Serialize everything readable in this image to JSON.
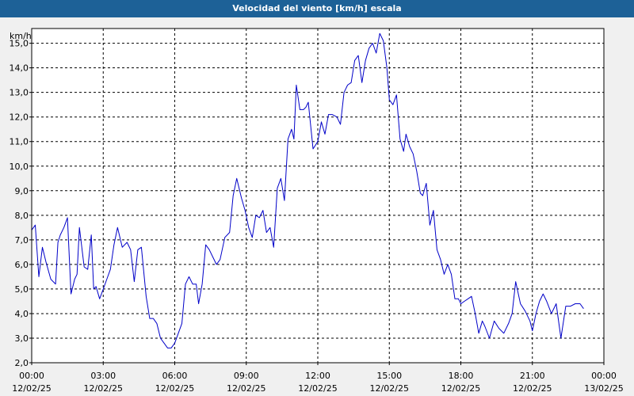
{
  "window": {
    "title": "Velocidad del viento [km/h] escala"
  },
  "chart_data": {
    "type": "line",
    "title": "Velocidad del viento [km/h] escala",
    "ylabel": "km/h",
    "xlabel": "",
    "ylim": [
      2.0,
      15.6
    ],
    "xlim": [
      "12/02/25 00:00",
      "13/02/25 00:00"
    ],
    "grid": true,
    "y_ticks": [
      "2,0",
      "3,0",
      "4,0",
      "5,0",
      "6,0",
      "7,0",
      "8,0",
      "9,0",
      "10,0",
      "11,0",
      "12,0",
      "13,0",
      "14,0",
      "15,0"
    ],
    "x_ticks": [
      {
        "time": "00:00",
        "date": "12/02/25"
      },
      {
        "time": "03:00",
        "date": "12/02/25"
      },
      {
        "time": "06:00",
        "date": "12/02/25"
      },
      {
        "time": "09:00",
        "date": "12/02/25"
      },
      {
        "time": "12:00",
        "date": "12/02/25"
      },
      {
        "time": "15:00",
        "date": "12/02/25"
      },
      {
        "time": "18:00",
        "date": "12/02/25"
      },
      {
        "time": "21:00",
        "date": "12/02/25"
      },
      {
        "time": "00:00",
        "date": "13/02/25"
      }
    ],
    "colors": {
      "series": "#0000c8",
      "grid": "#000000",
      "plot_bg": "#ffffff"
    },
    "series": [
      {
        "x_hours": [
          0.0,
          0.15,
          0.3,
          0.45,
          0.6,
          0.8,
          1.0,
          1.1,
          1.2,
          1.35,
          1.5,
          1.65,
          1.8,
          1.9,
          2.0,
          2.2,
          2.35,
          2.5,
          2.6,
          2.7,
          2.85,
          3.0,
          3.15,
          3.3,
          3.45,
          3.6,
          3.8,
          4.0,
          4.15,
          4.3,
          4.45,
          4.6,
          4.8,
          4.95,
          5.1,
          5.25,
          5.4,
          5.55,
          5.7,
          5.85,
          6.0,
          6.15,
          6.3,
          6.45,
          6.6,
          6.75,
          6.9,
          7.0,
          7.15,
          7.3,
          7.45,
          7.6,
          7.75,
          7.9,
          8.1,
          8.3,
          8.45,
          8.6,
          8.8,
          8.95,
          9.1,
          9.25,
          9.4,
          9.55,
          9.7,
          9.85,
          10.0,
          10.15,
          10.3,
          10.45,
          10.6,
          10.75,
          10.9,
          11.0,
          11.1,
          11.25,
          11.4,
          11.5,
          11.6,
          11.8,
          12.0,
          12.15,
          12.3,
          12.45,
          12.6,
          12.8,
          12.95,
          13.1,
          13.25,
          13.4,
          13.55,
          13.7,
          13.85,
          14.0,
          14.15,
          14.3,
          14.45,
          14.6,
          14.75,
          14.9,
          15.0,
          15.15,
          15.3,
          15.45,
          15.6,
          15.7,
          15.85,
          16.0,
          16.15,
          16.3,
          16.4,
          16.55,
          16.7,
          16.85,
          17.0,
          17.15,
          17.3,
          17.45,
          17.6,
          17.75,
          17.9,
          18.0,
          18.15,
          18.3,
          18.45,
          18.6,
          18.75,
          18.9,
          19.0,
          19.2,
          19.4,
          19.6,
          19.8,
          20.0,
          20.15,
          20.3,
          20.5,
          20.7,
          20.9,
          21.0,
          21.15,
          21.3,
          21.45,
          21.6,
          21.8,
          22.0,
          22.2,
          22.4,
          22.6,
          22.8,
          23.0,
          23.15,
          23.3,
          23.5,
          23.7,
          23.85,
          24.0
        ],
        "values": [
          7.4,
          7.6,
          5.5,
          6.7,
          6.1,
          5.4,
          5.2,
          6.9,
          7.2,
          7.5,
          7.9,
          4.8,
          5.4,
          5.6,
          7.5,
          5.9,
          5.8,
          7.2,
          5.0,
          5.1,
          4.6,
          5.0,
          5.4,
          5.8,
          6.8,
          7.5,
          6.7,
          6.9,
          6.6,
          5.3,
          6.6,
          6.7,
          4.7,
          3.8,
          3.8,
          3.6,
          3.0,
          2.8,
          2.6,
          2.6,
          2.8,
          3.2,
          3.6,
          5.2,
          5.5,
          5.2,
          5.2,
          4.4,
          5.2,
          6.8,
          6.6,
          6.3,
          6.0,
          6.2,
          7.1,
          7.3,
          8.8,
          9.5,
          8.7,
          8.2,
          7.5,
          7.1,
          8.0,
          7.9,
          8.2,
          7.3,
          7.5,
          6.7,
          9.1,
          9.5,
          8.6,
          11.1,
          11.5,
          11.1,
          13.3,
          12.3,
          12.3,
          12.4,
          12.6,
          10.7,
          11.0,
          11.8,
          11.3,
          12.1,
          12.1,
          12.0,
          11.7,
          13.0,
          13.3,
          13.4,
          14.3,
          14.5,
          13.4,
          14.3,
          14.8,
          15.0,
          14.6,
          15.4,
          15.1,
          14.0,
          12.7,
          12.5,
          12.9,
          11.1,
          10.6,
          11.3,
          10.8,
          10.5,
          9.8,
          8.9,
          8.8,
          9.3,
          7.6,
          8.2,
          6.6,
          6.2,
          5.6,
          6.0,
          5.6,
          4.6,
          4.6,
          4.4,
          4.5,
          4.6,
          4.7,
          4.0,
          3.2,
          3.7,
          3.5,
          3.0,
          3.7,
          3.4,
          3.2,
          3.6,
          4.0,
          5.3,
          4.4,
          4.1,
          3.7,
          3.3,
          4.0,
          4.5,
          4.8,
          4.5,
          4.0,
          4.4,
          3.0,
          4.3,
          4.3,
          4.4,
          4.4,
          4.2
        ]
      }
    ]
  }
}
